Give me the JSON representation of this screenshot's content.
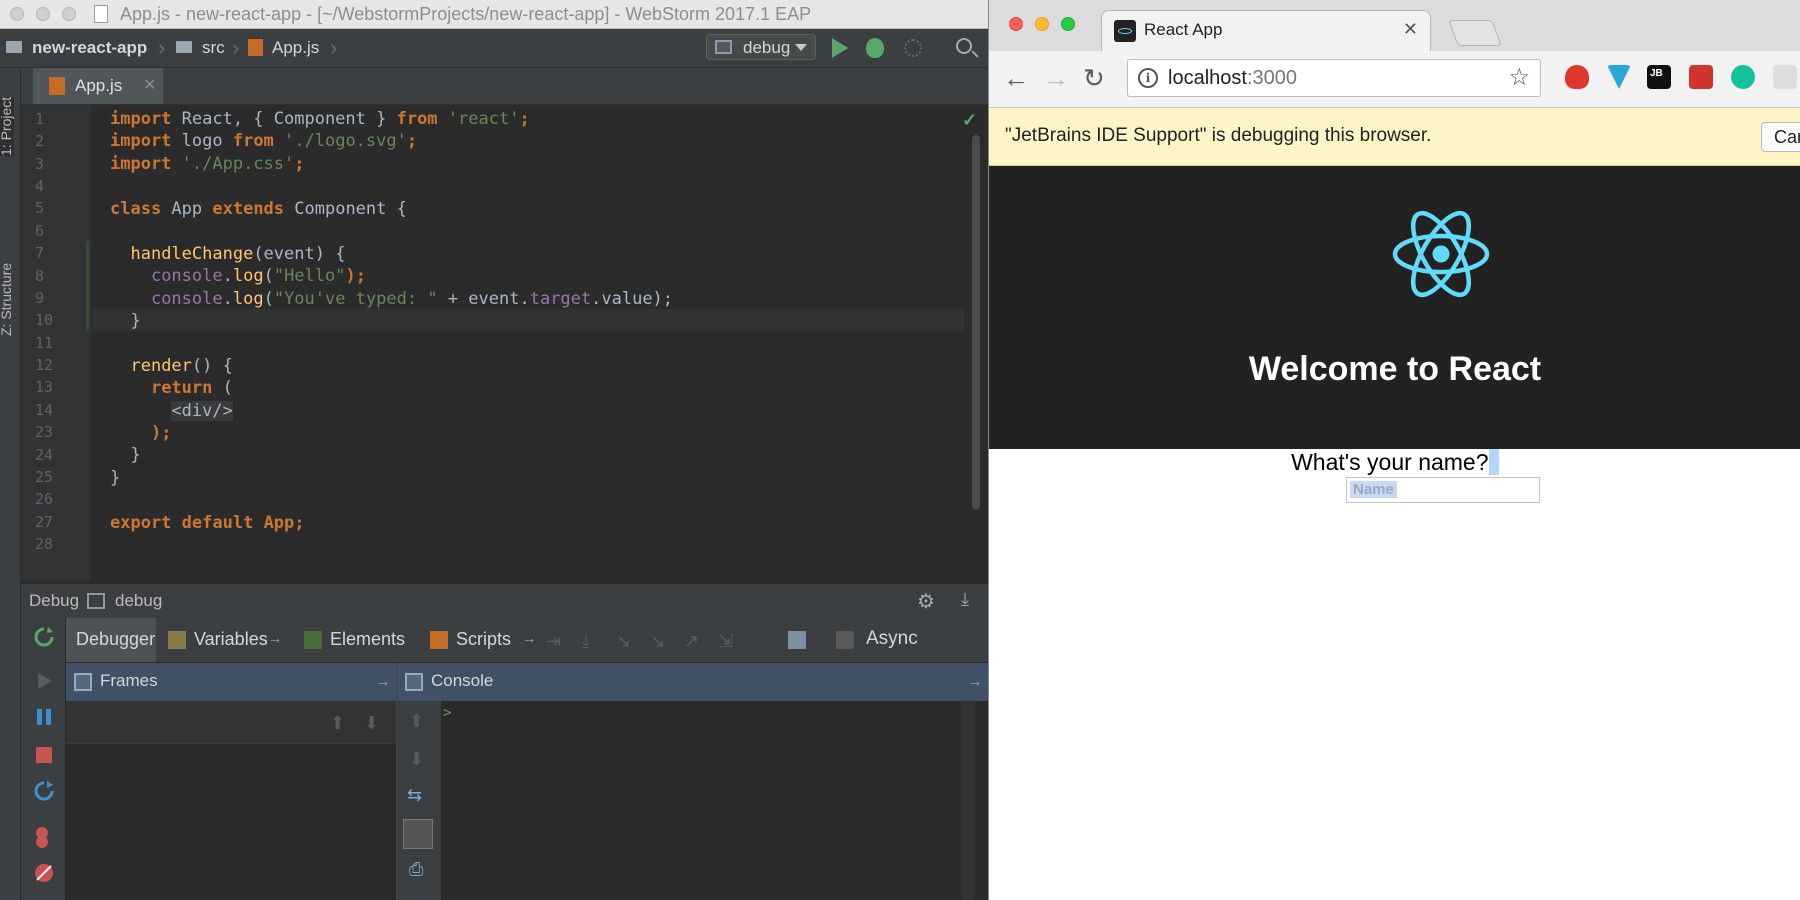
{
  "ide": {
    "window_title": "App.js - new-react-app - [~/WebstormProjects/new-react-app] - WebStorm 2017.1 EAP",
    "breadcrumbs": [
      "new-react-app",
      "src",
      "App.js"
    ],
    "run_config": "debug",
    "side_tabs": [
      "1: Project",
      "Z: Structure"
    ],
    "editor_tab": "App.js",
    "line_numbers": [
      "1",
      "2",
      "3",
      "4",
      "5",
      "6",
      "7",
      "8",
      "9",
      "10",
      "11",
      "12",
      "13",
      "14",
      "23",
      "24",
      "25",
      "26",
      "27",
      "28"
    ],
    "code": {
      "l1": {
        "kw1": "import",
        "t1": " React, { Component } ",
        "kw2": "from",
        "s1": " 'react'",
        "t2": ";"
      },
      "l2": {
        "kw1": "import",
        "t1": " logo ",
        "kw2": "from",
        "s1": " './logo.svg'",
        "t2": ";"
      },
      "l3": {
        "kw1": "import",
        "s1": " './App.css'",
        "t2": ";"
      },
      "l5": {
        "kw1": "class",
        "t1": " App ",
        "kw2": "extends",
        "t2": " Component {"
      },
      "l7": {
        "fn": "handleChange",
        "t1": "(event) {"
      },
      "l8": {
        "p1": "console",
        "t1": ".",
        "fn": "log",
        "t2": "(",
        "s1": "\"Hello\"",
        "t3": ");"
      },
      "l9": {
        "p1": "console",
        "t1": ".",
        "fn": "log",
        "t2": "(",
        "s1": "\"You've typed: \"",
        "t3": " + event.",
        "p2": "target",
        "t4": ".value);"
      },
      "l10": {
        "t1": "}"
      },
      "l12": {
        "fn": "render",
        "t1": "() {"
      },
      "l13": {
        "kw1": "return",
        "t1": " ("
      },
      "l14": {
        "tag": "<div/>"
      },
      "l23": {
        "t1": ");"
      },
      "l24": {
        "t1": "}"
      },
      "l25": {
        "t1": "}"
      },
      "l27": {
        "kw1": "export",
        "kw2": "default",
        "t1": " App;"
      }
    },
    "debug": {
      "header_label": "Debug",
      "config_label": "debug",
      "tabs": [
        "Debugger",
        "Variables",
        "Elements",
        "Scripts"
      ],
      "async_label": "Async",
      "frames_label": "Frames",
      "console_label": "Console",
      "console_prompt": ">"
    }
  },
  "browser": {
    "tab_title": "React App",
    "url_host": "localhost",
    "url_port": ":3000",
    "infobar_text": "\"JetBrains IDE Support\" is debugging this browser.",
    "infobar_button": "Cancel",
    "page": {
      "heading": "Welcome to React",
      "prompt": "What's your name?",
      "input_placeholder": "Name"
    },
    "colors": {
      "react_accent": "#61dafb",
      "header_bg": "#222222"
    }
  }
}
